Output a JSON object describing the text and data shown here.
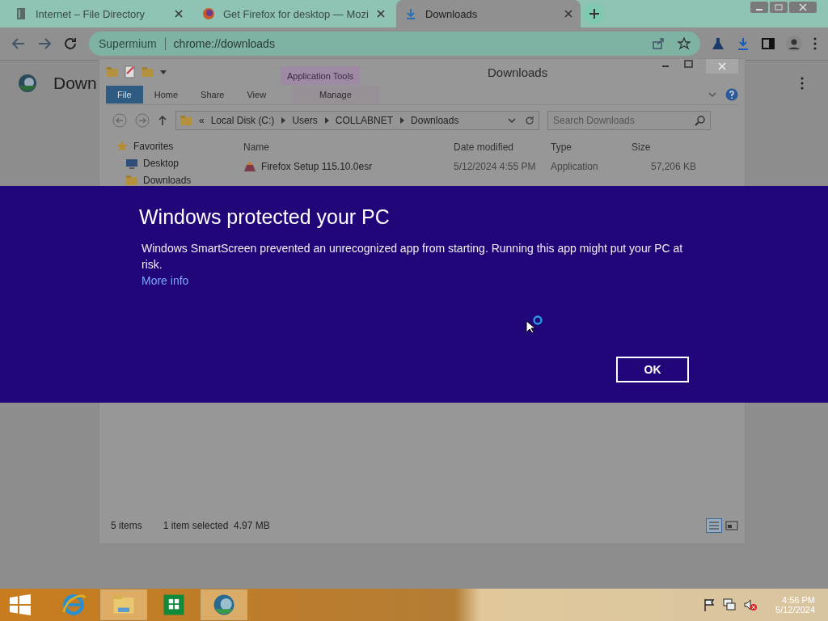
{
  "browser": {
    "tabs": [
      {
        "title": "Internet – File Directory",
        "selected": false
      },
      {
        "title": "Get Firefox for desktop — Mozi",
        "selected": false
      },
      {
        "title": "Downloads",
        "selected": true
      }
    ],
    "address": {
      "site": "Supermium",
      "url": "chrome://downloads"
    },
    "page_title": "Down"
  },
  "explorer": {
    "title": "Downloads",
    "context_tab": "Application Tools",
    "ribbon_tabs": [
      {
        "label": "File",
        "selected": true
      },
      {
        "label": "Home",
        "selected": false
      },
      {
        "label": "Share",
        "selected": false
      },
      {
        "label": "View",
        "selected": false
      },
      {
        "label": "Manage",
        "selected": false
      }
    ],
    "path": [
      "«",
      "Local Disk (C:)",
      "Users",
      "COLLABNET",
      "Downloads"
    ],
    "search": {
      "placeholder": "Search Downloads"
    },
    "sidebar": [
      {
        "label": "Favorites",
        "children": [
          {
            "label": "Desktop"
          },
          {
            "label": "Downloads"
          }
        ]
      }
    ],
    "columns": [
      "Name",
      "Date modified",
      "Type",
      "Size"
    ],
    "rows": [
      {
        "name": "Firefox Setup 115.10.0esr",
        "date": "5/12/2024 4:55 PM",
        "type": "Application",
        "size": "57,206 KB"
      }
    ],
    "status": {
      "count": "5 items",
      "selection": "1 item selected  4.97 MB"
    }
  },
  "dialog": {
    "title": "Windows protected your PC",
    "message": "Windows SmartScreen prevented an unrecognized app from starting. Running this app might put your PC at risk.",
    "link": "More info",
    "button": "OK"
  },
  "taskbar": {
    "apps": [
      {
        "selected": false
      },
      {
        "selected": true
      },
      {
        "selected": false
      },
      {
        "selected": true
      }
    ],
    "time": "4:56 PM",
    "date": "5/12/2024"
  }
}
